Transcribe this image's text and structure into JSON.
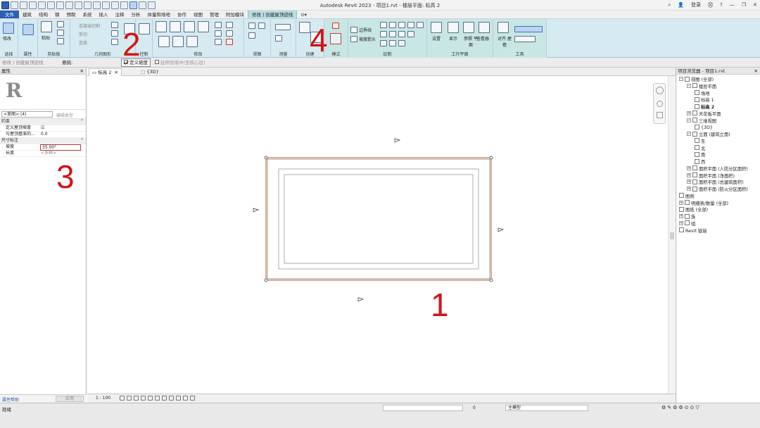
{
  "window": {
    "title": "Autodesk Revit 2023 - 项目1.rvt - 楼层平面: 标高 2",
    "sign_in": "登录",
    "help": "?"
  },
  "menu": {
    "tabs": [
      "文件",
      "建筑",
      "结构",
      "钢",
      "预制",
      "系统",
      "插入",
      "注释",
      "分析",
      "体量和场地",
      "协作",
      "视图",
      "管理",
      "附加模块",
      "修改 | 创建屋顶迹线"
    ]
  },
  "ribbon": {
    "modify_label": "修改",
    "paste_label": "粘贴",
    "connect_label": "连接端切割",
    "cut_label": "剪切",
    "join_label": "连接",
    "boundary_line": "边界线",
    "slope_arrow": "坡度箭头",
    "set_label": "设置",
    "show_label": "显示",
    "ref_plane_label": "参照 平面",
    "viewer_label": "查看器",
    "align_label": "对齐 屋檐",
    "panels": {
      "select": "选择",
      "properties": "属性",
      "clipboard": "剪贴板",
      "geometry": "几何图形",
      "control": "控制",
      "modify": "修改",
      "view": "视图",
      "measure": "测量",
      "create": "创建",
      "mode": "模式",
      "draw": "绘制",
      "work_plane": "工作平面",
      "tools": "工具"
    }
  },
  "options_bar": {
    "context": "修改 | 创建屋顶迹线",
    "layer": "悬挑:",
    "defines_slope": "定义坡度",
    "extend_to_wall": "延伸到墙中(至核心层)"
  },
  "properties": {
    "title": "属性",
    "type_selector": "<草图> (4)",
    "edit_type": "编辑类型",
    "groups": [
      {
        "name": "约束",
        "rows": [
          {
            "key": "定义屋顶坡度",
            "value": "☑"
          },
          {
            "key": "与屋顶基准的...",
            "value": "0.0"
          }
        ]
      },
      {
        "name": "尺寸标注",
        "rows": [
          {
            "key": "坡度",
            "value": "35.00°"
          },
          {
            "key": "长度",
            "value": "<多种>"
          }
        ]
      }
    ],
    "help_link": "属性帮助",
    "apply": "应用"
  },
  "view_tabs": [
    {
      "label": "标高 2",
      "active": true
    },
    {
      "label": "{3D}",
      "active": false
    }
  ],
  "view_control": {
    "scale": "1 : 100"
  },
  "project_browser": {
    "title": "项目浏览器 - 项目1.rvt",
    "nodes": [
      {
        "label": "视图 (全部)",
        "level": 0,
        "exp": "−"
      },
      {
        "label": "楼层平面",
        "level": 1,
        "exp": "−"
      },
      {
        "label": "场地",
        "level": 2
      },
      {
        "label": "标高 1",
        "level": 2
      },
      {
        "label": "标高 2",
        "level": 2,
        "bold": true
      },
      {
        "label": "天花板平面",
        "level": 1,
        "exp": "+"
      },
      {
        "label": "三维视图",
        "level": 1,
        "exp": "−"
      },
      {
        "label": "{3D}",
        "level": 2
      },
      {
        "label": "立面 (建筑立面)",
        "level": 1,
        "exp": "−"
      },
      {
        "label": "东",
        "level": 2
      },
      {
        "label": "北",
        "level": 2
      },
      {
        "label": "南",
        "level": 2
      },
      {
        "label": "西",
        "level": 2
      },
      {
        "label": "面积平面 (人防分区面积)",
        "level": 1,
        "exp": "+"
      },
      {
        "label": "面积平面 (净面积)",
        "level": 1,
        "exp": "+"
      },
      {
        "label": "面积平面 (总建筑面积)",
        "level": 1,
        "exp": "+"
      },
      {
        "label": "面积平面 (防火分区面积)",
        "level": 1,
        "exp": "+"
      },
      {
        "label": "图例",
        "level": 0
      },
      {
        "label": "明细表/数量 (全部)",
        "level": 0,
        "exp": "+"
      },
      {
        "label": "图纸 (全部)",
        "level": 0
      },
      {
        "label": "族",
        "level": 0,
        "exp": "+"
      },
      {
        "label": "组",
        "level": 0,
        "exp": "+"
      },
      {
        "label": "Revit 链接",
        "level": 0
      }
    ]
  },
  "status": {
    "message": "就绪",
    "model": "主模型",
    "worksets_count": "0"
  },
  "annotations": [
    "1",
    "2",
    "3",
    "4"
  ],
  "colors": {
    "accent": "#2b61b5",
    "context_tab": "#b8dde0",
    "annotation_red": "#d21414",
    "sketch_line": "#c45a2a"
  }
}
